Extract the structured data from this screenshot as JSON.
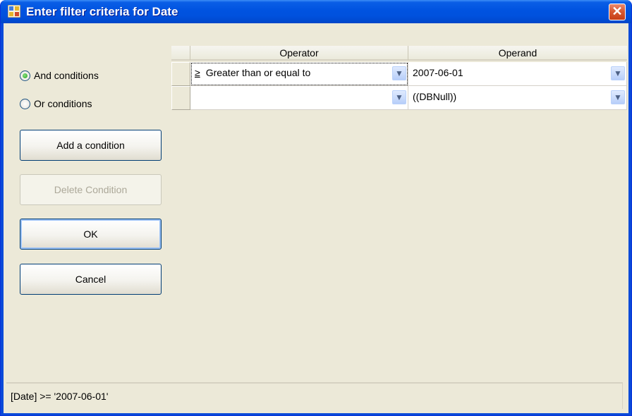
{
  "window": {
    "title": "Enter filter criteria for Date",
    "close_glyph": "✕"
  },
  "radios": [
    {
      "label": "And conditions",
      "selected": true
    },
    {
      "label": "Or conditions",
      "selected": false
    }
  ],
  "buttons": {
    "add": "Add a condition",
    "delete": "Delete Condition",
    "ok": "OK",
    "cancel": "Cancel"
  },
  "grid": {
    "columns": [
      "Operator",
      "Operand"
    ],
    "rows": [
      {
        "operator_symbol": "≥",
        "operator_text": "Greater than or equal to",
        "operand": "2007-06-01"
      },
      {
        "operator_symbol": "",
        "operator_text": "",
        "operand": "((DBNull))"
      }
    ]
  },
  "status_text": "[Date] >= '2007-06-01'",
  "icons": {
    "dropdown": "chevron-down-icon",
    "app": "window-app-icon"
  }
}
